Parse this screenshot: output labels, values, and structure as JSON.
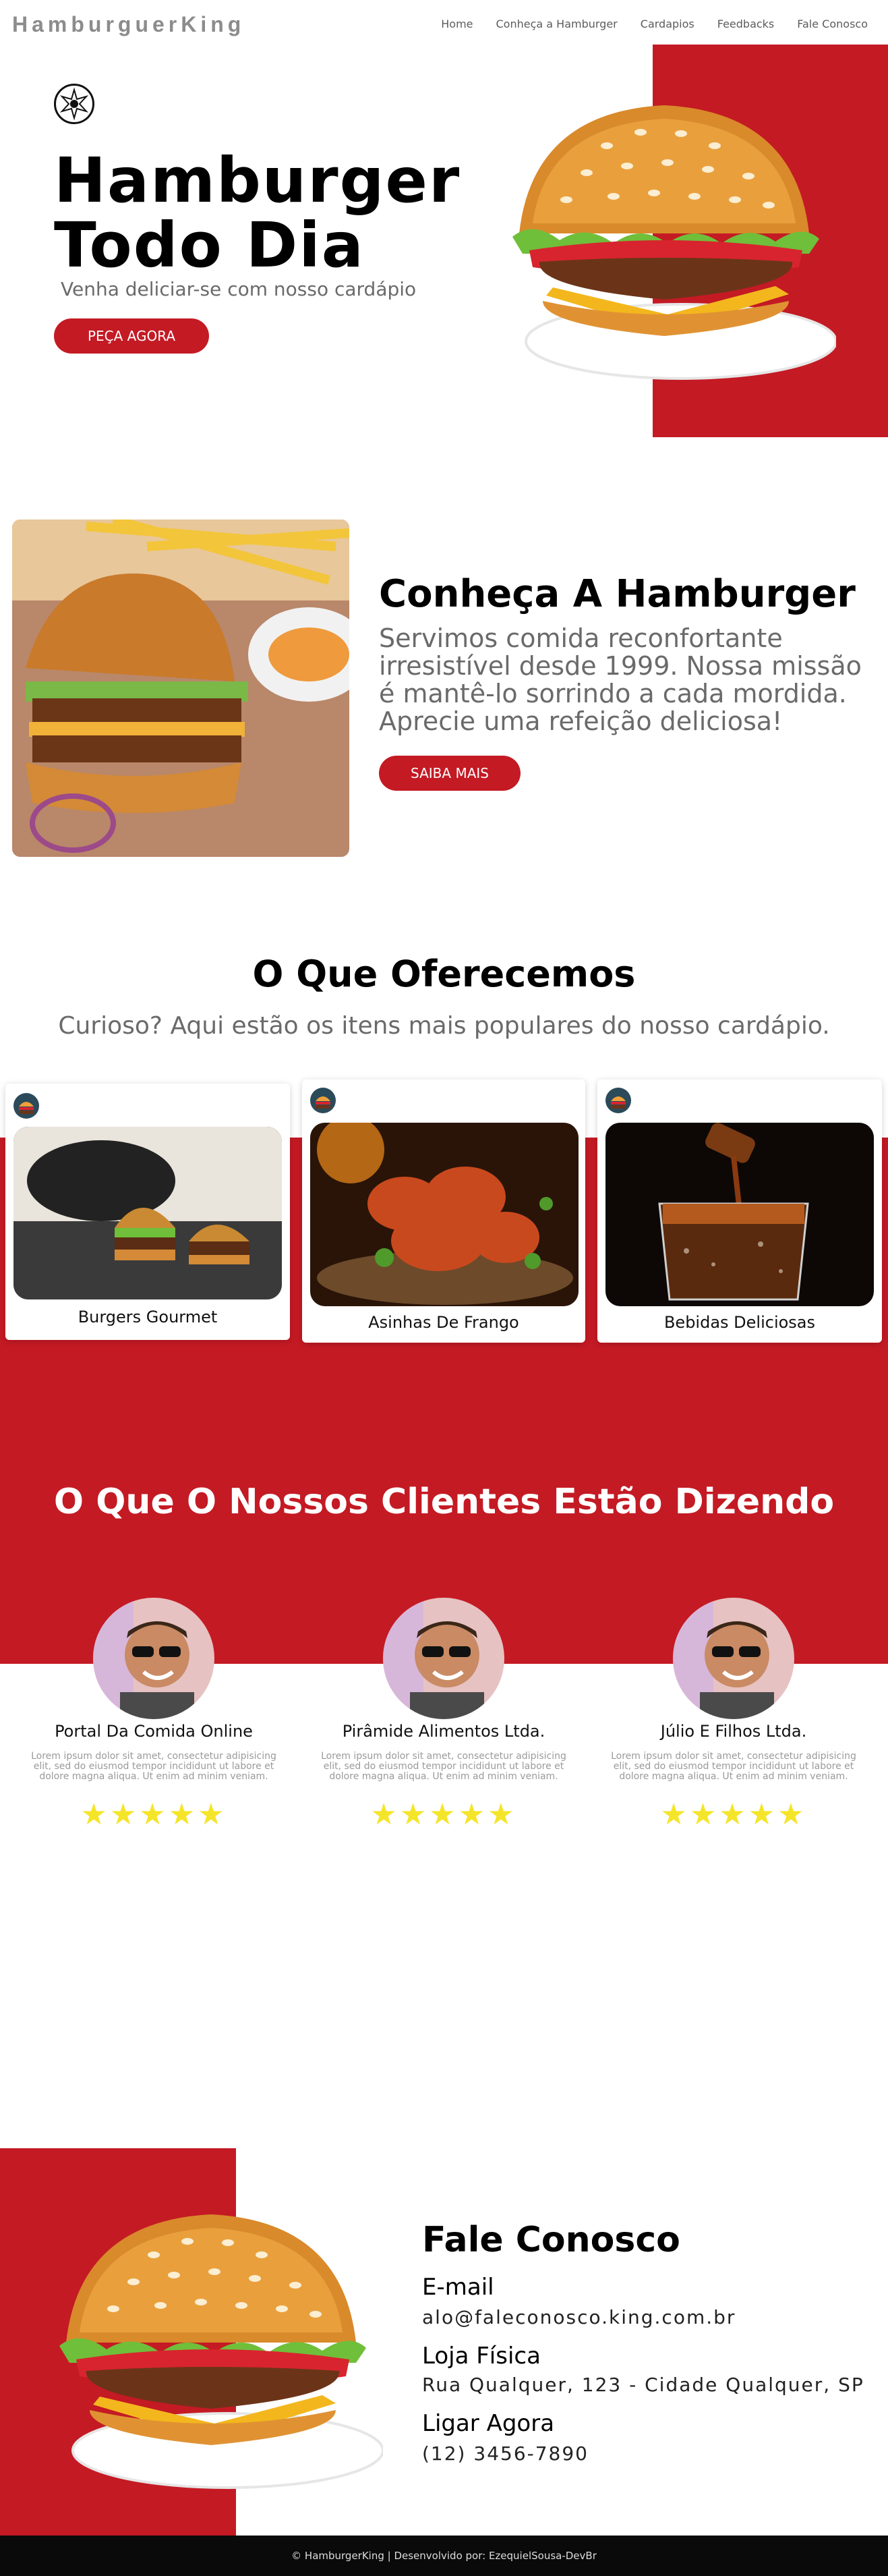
{
  "brand": {
    "logo_text": "HamburguerKing",
    "accent": "#c41a24",
    "star_color": "#f5e52a"
  },
  "nav": {
    "items": [
      "Home",
      "Conheça a Hamburger",
      "Cardapios",
      "Feedbacks",
      "Fale Conosco"
    ]
  },
  "hero": {
    "badge_icon": "emblem-icon",
    "title_line1": "Hamburger",
    "title_line2": "Todo Dia",
    "subtitle": "Venha deliciar-se com nosso cardápio",
    "cta": "PEÇA AGORA"
  },
  "about": {
    "title": "Conheça A Hamburger",
    "text": "Servimos comida reconfortante irresistível desde 1999. Nossa missão é mantê-lo sorrindo a cada mordida. Aprecie uma refeição deliciosa!",
    "cta": "SAIBA MAIS"
  },
  "offer": {
    "title": "O Que Oferecemos",
    "subtitle": "Curioso? Aqui estão os itens mais populares do nosso cardápio.",
    "items": [
      {
        "label": "Burgers Gourmet"
      },
      {
        "label": "Asinhas De Frango"
      },
      {
        "label": "Bebidas Deliciosas"
      }
    ]
  },
  "testimonials": {
    "title": "O Que O Nossos Clientes Estão Dizendo",
    "items": [
      {
        "name": "Portal Da Comida Online",
        "text": "Lorem ipsum dolor sit amet, consectetur adipisicing elit, sed do eiusmod tempor incididunt ut labore et dolore magna aliqua. Ut enim ad minim veniam.",
        "stars": "★★★★★"
      },
      {
        "name": "Pirâmide Alimentos Ltda.",
        "text": "Lorem ipsum dolor sit amet, consectetur adipisicing elit, sed do eiusmod tempor incididunt ut labore et dolore magna aliqua. Ut enim ad minim veniam.",
        "stars": "★★★★★"
      },
      {
        "name": "Júlio E Filhos Ltda.",
        "text": "Lorem ipsum dolor sit amet, consectetur adipisicing elit, sed do eiusmod tempor incididunt ut labore et dolore magna aliqua. Ut enim ad minim veniam.",
        "stars": "★★★★★"
      }
    ]
  },
  "contact": {
    "title": "Fale Conosco",
    "email_label": "E-mail",
    "email_value": "alo@faleconosco.king.com.br",
    "store_label": "Loja Física",
    "store_value": "Rua Qualquer, 123 - Cidade Qualquer, SP",
    "phone_label": "Ligar Agora",
    "phone_value": "(12) 3456-7890"
  },
  "footer": {
    "text": "© HamburgerKing | Desenvolvido por: EzequielSousa-DevBr"
  }
}
